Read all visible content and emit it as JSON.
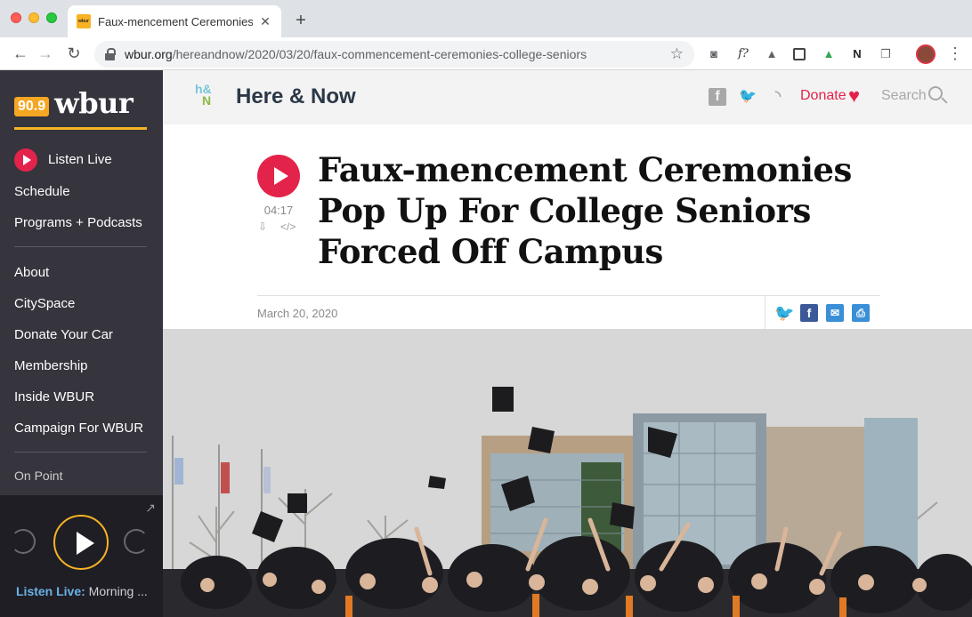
{
  "browser": {
    "tab_title": "Faux-mencement Ceremonies",
    "tab_favicon": "wbur",
    "new_tab": "+",
    "url_host": "wbur.org",
    "url_path": "/hereandnow/2020/03/20/faux-commencement-ceremonies-college-seniors",
    "icons": [
      "back-icon",
      "forward-icon",
      "reload-icon",
      "lock-icon",
      "star-icon",
      "camera-icon",
      "fontface-icon",
      "drive-icon",
      "notion-icon",
      "profile-avatar",
      "menu-icon"
    ],
    "ext_fonts_label": "f?"
  },
  "sidebar": {
    "logo_freq": "90.9",
    "logo_word": "wbur",
    "listen_live": "Listen Live",
    "items_top": [
      "Schedule",
      "Programs + Podcasts"
    ],
    "items_mid": [
      "About",
      "CitySpace",
      "Donate Your Car",
      "Membership",
      "Inside WBUR",
      "Campaign For WBUR"
    ],
    "on_point": "On Point",
    "player": {
      "status_label": "Listen Live:",
      "status_text": " Morning ..."
    }
  },
  "show": {
    "logo_h": "h&",
    "logo_n": "N",
    "title": "Here & Now",
    "donate": "Donate",
    "search": "Search",
    "accent": "#e3234a"
  },
  "article": {
    "duration": "04:17",
    "download_glyph": "⇩",
    "embed_glyph": "</>",
    "headline": "Faux-mencement Ceremonies Pop Up For College Seniors Forced Off Campus",
    "date": "March 20, 2020",
    "share_icons": [
      "twitter-icon",
      "facebook-icon",
      "email-icon",
      "print-icon"
    ]
  }
}
